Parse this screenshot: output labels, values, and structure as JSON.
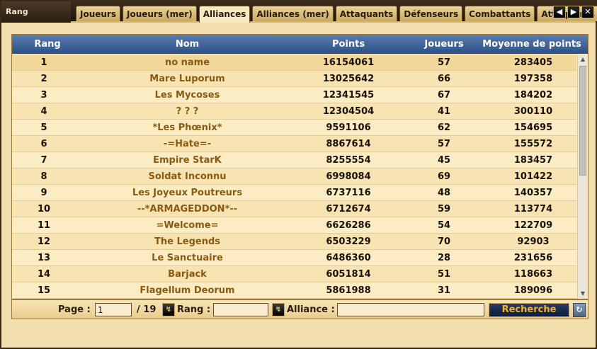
{
  "window": {
    "title": "Rang"
  },
  "tabs": [
    {
      "label": "Joueurs",
      "active": false
    },
    {
      "label": "Joueurs (mer)",
      "active": false
    },
    {
      "label": "Alliances",
      "active": true
    },
    {
      "label": "Alliances (mer)",
      "active": false
    },
    {
      "label": "Attaquants",
      "active": false
    },
    {
      "label": "Défenseurs",
      "active": false
    },
    {
      "label": "Combattants",
      "active": false
    },
    {
      "label": "Attaquants (allian",
      "active": false
    }
  ],
  "nav": {
    "prev": "◀",
    "next": "▶",
    "close": "✕"
  },
  "table": {
    "headers": {
      "rank": "Rang",
      "name": "Nom",
      "points": "Points",
      "players": "Joueurs",
      "average": "Moyenne de points"
    },
    "rows": [
      {
        "rank": "1",
        "name": "no name",
        "points": "16154061",
        "players": "57",
        "average": "283405"
      },
      {
        "rank": "2",
        "name": "Mare Luporum",
        "points": "13025642",
        "players": "66",
        "average": "197358"
      },
      {
        "rank": "3",
        "name": "Les Mycoses",
        "points": "12341545",
        "players": "67",
        "average": "184202"
      },
      {
        "rank": "4",
        "name": "? ? ?",
        "points": "12304504",
        "players": "41",
        "average": "300110"
      },
      {
        "rank": "5",
        "name": "*Les Phœnix*",
        "points": "9591106",
        "players": "62",
        "average": "154695"
      },
      {
        "rank": "6",
        "name": "-=Hate=-",
        "points": "8867614",
        "players": "57",
        "average": "155572"
      },
      {
        "rank": "7",
        "name": "Empire StarK",
        "points": "8255554",
        "players": "45",
        "average": "183457"
      },
      {
        "rank": "8",
        "name": "Soldat Inconnu",
        "points": "6998084",
        "players": "69",
        "average": "101422"
      },
      {
        "rank": "9",
        "name": "Les Joyeux Poutreurs",
        "points": "6737116",
        "players": "48",
        "average": "140357"
      },
      {
        "rank": "10",
        "name": "--*ARMAGEDDON*--",
        "points": "6712674",
        "players": "59",
        "average": "113774"
      },
      {
        "rank": "11",
        "name": "=Welcome=",
        "points": "6626286",
        "players": "54",
        "average": "122709"
      },
      {
        "rank": "12",
        "name": "The Legends",
        "points": "6503229",
        "players": "70",
        "average": "92903"
      },
      {
        "rank": "13",
        "name": "Le Sanctuaire",
        "points": "6486360",
        "players": "28",
        "average": "231656"
      },
      {
        "rank": "14",
        "name": "Barjack",
        "points": "6051814",
        "players": "51",
        "average": "118663"
      },
      {
        "rank": "15",
        "name": "Flagellum Deorum",
        "points": "5861988",
        "players": "31",
        "average": "189096"
      }
    ]
  },
  "footer": {
    "page_label": "Page :",
    "page_value": "1",
    "page_total": "/ 19",
    "rank_label": "Rang :",
    "rank_value": "",
    "alliance_label": "Alliance :",
    "alliance_value": "",
    "search_label": "Recherche"
  },
  "colors": {
    "header": "#2c4f85",
    "name_text": "#8a5a12",
    "search_text": "#f0b428"
  }
}
